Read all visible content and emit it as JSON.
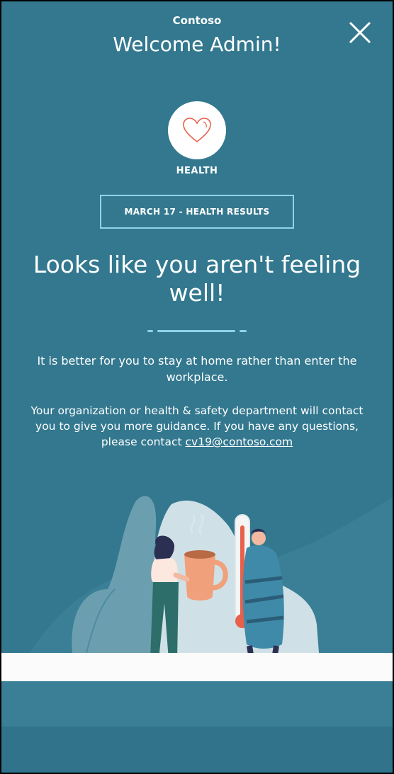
{
  "header": {
    "app_name": "Contoso",
    "welcome": "Welcome Admin!",
    "close_icon": "close-icon"
  },
  "category": {
    "icon": "heart-icon",
    "label": "HEALTH"
  },
  "results_label": "MARCH 17 - HEALTH RESULTS",
  "headline": "Looks like you aren't feeling well!",
  "advice": "It is better for you to stay at home rather than enter the workplace.",
  "contact": {
    "text": "Your organization or health & safety department will contact you to give you more guidance. If you have any questions, please contact",
    "email": "cv19@contoso.com"
  },
  "colors": {
    "background": "#33788f",
    "accent_border": "#8fd3ea",
    "heart": "#e8604c"
  }
}
